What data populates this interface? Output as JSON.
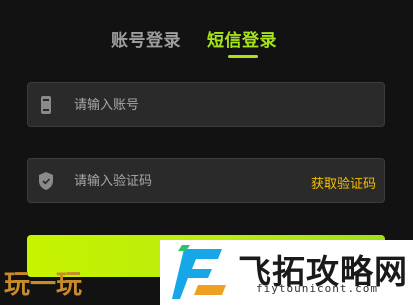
{
  "tabs": {
    "account_label": "账号登录",
    "sms_label": "短信登录",
    "active": "sms"
  },
  "account_field": {
    "placeholder": "请输入账号",
    "icon": "phone-icon"
  },
  "code_field": {
    "placeholder": "请输入验证码",
    "icon": "shield-icon",
    "get_code_label": "获取验证码"
  },
  "submit": {
    "label": ""
  },
  "watermark_left": {
    "text": "玩一玩"
  },
  "watermark_right": {
    "brand": "飞拓攻略网",
    "url": "fiytounicont.com"
  },
  "colors": {
    "background": "#121212",
    "accent_green": "#a6e415",
    "get_code_yellow": "#f5c000",
    "field_bg": "#2a2a2a"
  }
}
